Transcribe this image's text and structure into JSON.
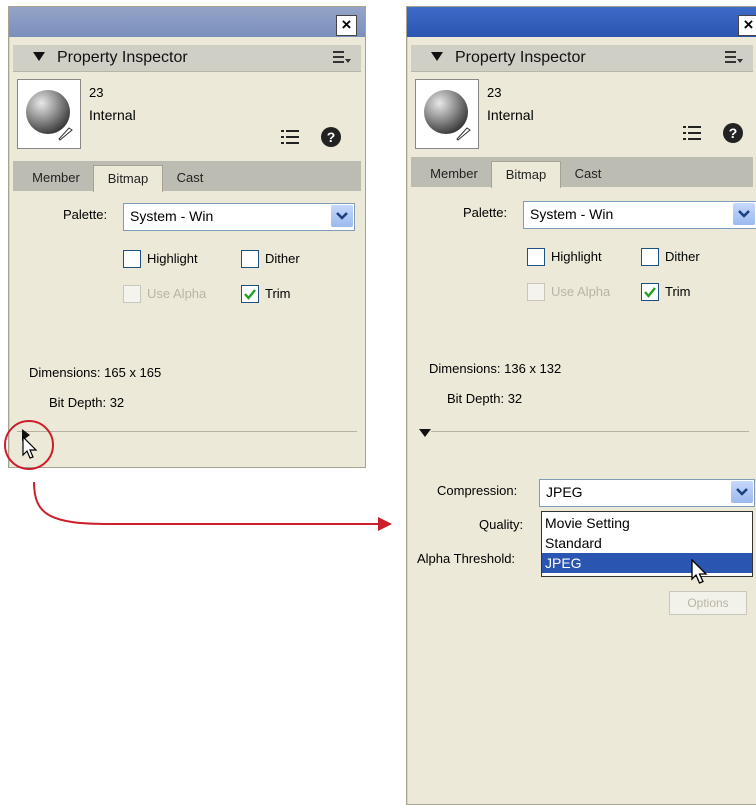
{
  "left_panel": {
    "title": "Property Inspector",
    "close_label": "×",
    "member_number": "23",
    "member_type": "Internal",
    "tabs": [
      "Member",
      "Bitmap",
      "Cast"
    ],
    "active_tab": "Bitmap",
    "palette_label": "Palette:",
    "palette_value": "System - Win",
    "checkboxes": {
      "highlight": "Highlight",
      "dither": "Dither",
      "use_alpha": "Use Alpha",
      "trim": "Trim"
    },
    "dimensions_label": "Dimensions: 165 x 165",
    "bit_depth_label": "Bit Depth: 32"
  },
  "right_panel": {
    "title": "Property Inspector",
    "close_label": "×",
    "member_number": "23",
    "member_type": "Internal",
    "tabs": [
      "Member",
      "Bitmap",
      "Cast"
    ],
    "active_tab": "Bitmap",
    "palette_label": "Palette:",
    "palette_value": "System - Win",
    "checkboxes": {
      "highlight": "Highlight",
      "dither": "Dither",
      "use_alpha": "Use Alpha",
      "trim": "Trim"
    },
    "dimensions_label": "Dimensions: 136 x 132",
    "bit_depth_label": "Bit Depth: 32",
    "compression_label": "Compression:",
    "compression_value": "JPEG",
    "quality_label": "Quality:",
    "alpha_threshold_label": "Alpha Threshold:",
    "compression_options": [
      "Movie Setting",
      "Standard",
      "JPEG"
    ],
    "selected_option": "JPEG",
    "options_button": "Options"
  },
  "colors": {
    "panel_bg": "#ece9d8",
    "active_title": "#2a55b0",
    "inactive_title": "#7b8fbd",
    "annotation_red": "#cc1e2a"
  }
}
